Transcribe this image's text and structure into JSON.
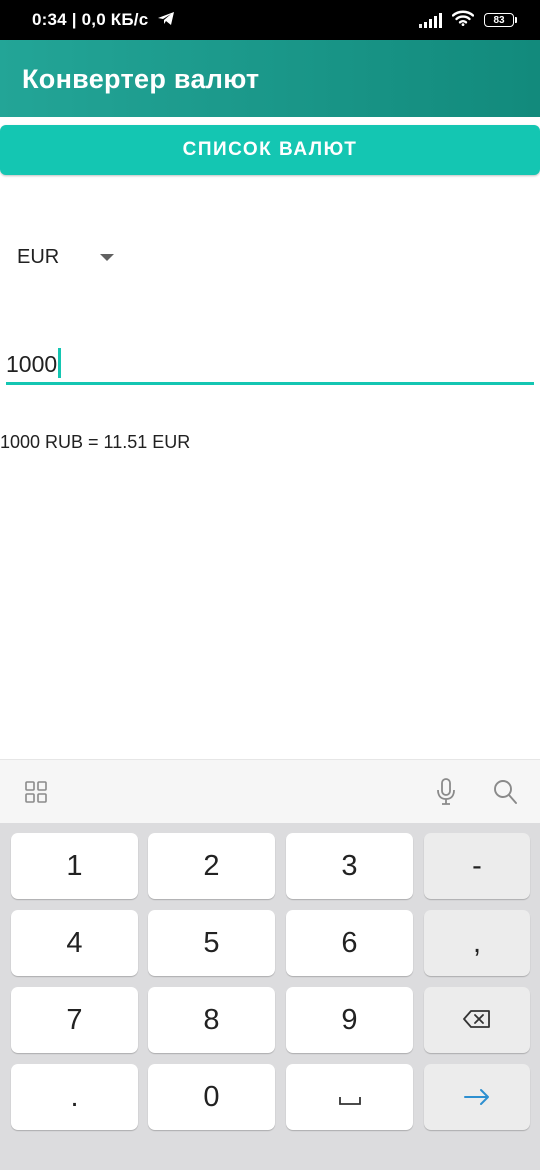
{
  "status_bar": {
    "time_and_speed": "0:34 | 0,0 КБ/с",
    "battery": "83"
  },
  "app_bar": {
    "title": "Конвертер валют"
  },
  "main": {
    "list_button_label": "СПИСОК ВАЛЮТ",
    "currency_spinner": {
      "selected": "EUR"
    },
    "amount_input": {
      "value": "1000"
    },
    "result_text": "1000 RUB = 11.51 EUR"
  },
  "keyboard": {
    "toolbar_icons": [
      "grid-icon",
      "microphone-icon",
      "search-icon"
    ],
    "keys": {
      "k1": "1",
      "k2": "2",
      "k3": "3",
      "minus": "-",
      "k4": "4",
      "k5": "5",
      "k6": "6",
      "comma": ",",
      "k7": "7",
      "k8": "8",
      "k9": "9",
      "dot": ".",
      "k0": "0"
    },
    "special_keys": [
      "backspace-icon",
      "space-icon",
      "enter-arrow-icon"
    ]
  },
  "colors": {
    "app_bar_start": "#23a597",
    "app_bar_end": "#128a7c",
    "accent": "#14c6b2",
    "enter_arrow": "#2d8fd0"
  }
}
